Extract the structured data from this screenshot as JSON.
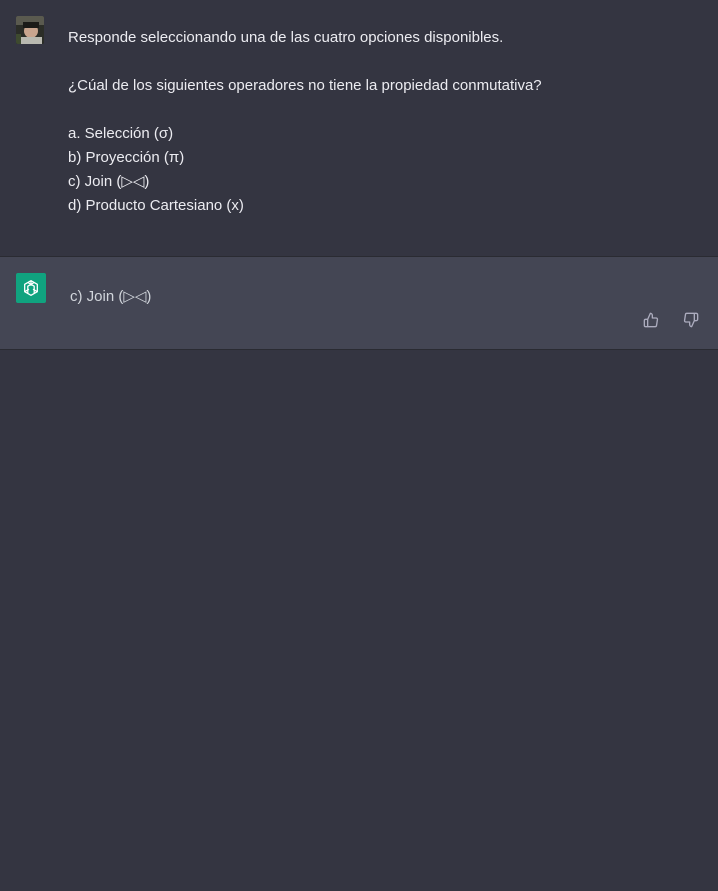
{
  "conversation": {
    "user_message": {
      "line1": "Responde seleccionando una de las cuatro opciones disponibles.",
      "question": "¿Cúal de los siguientes operadores no tiene la propiedad conmutativa?",
      "options": [
        "a. Selección (σ)",
        "b) Proyección (π)",
        "c) Join (▷◁)",
        "d) Producto Cartesiano (x)"
      ]
    },
    "assistant_message": {
      "text": "c) Join (▷◁)"
    }
  },
  "icons": {
    "user_avatar": "user-avatar",
    "bot_avatar": "openai-logo-icon",
    "thumbs_up": "thumbs-up-icon",
    "thumbs_down": "thumbs-down-icon"
  },
  "colors": {
    "background": "#343541",
    "assistant_background": "#444654",
    "bot_avatar": "#10a37f",
    "text": "#ececf1"
  }
}
